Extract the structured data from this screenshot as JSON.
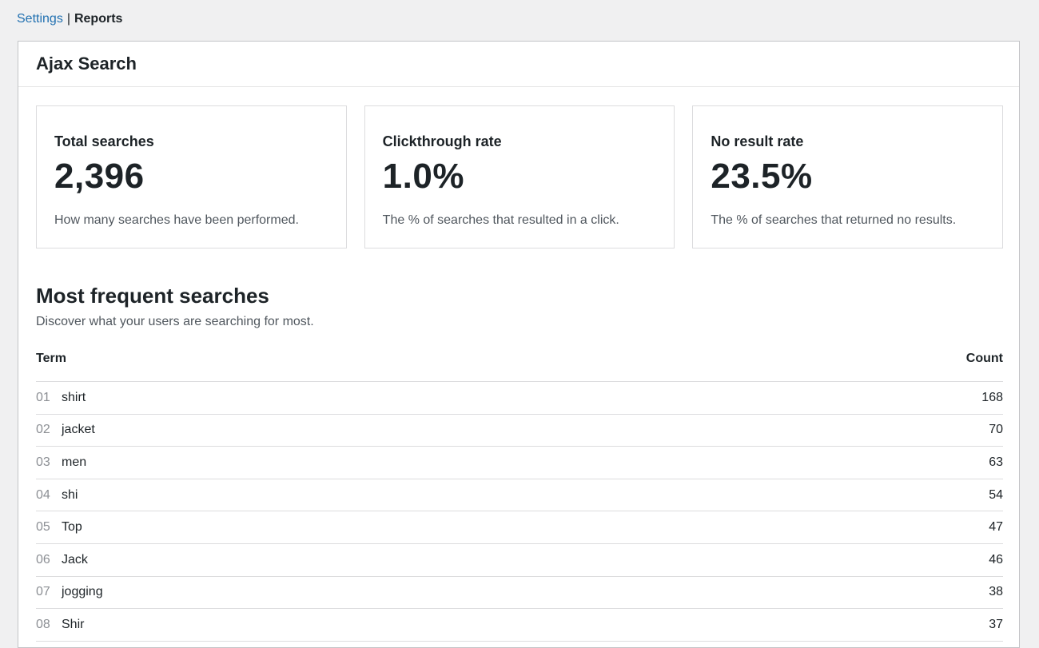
{
  "breadcrumb": {
    "settings_label": "Settings",
    "separator": "|",
    "reports_label": "Reports"
  },
  "panel": {
    "title": "Ajax Search"
  },
  "stats": [
    {
      "title": "Total searches",
      "value": "2,396",
      "description": "How many searches have been performed."
    },
    {
      "title": "Clickthrough rate",
      "value": "1.0%",
      "description": "The % of searches that resulted in a click."
    },
    {
      "title": "No result rate",
      "value": "23.5%",
      "description": "The % of searches that returned no results."
    }
  ],
  "frequent": {
    "title": "Most frequent searches",
    "description": "Discover what your users are searching for most.",
    "columns": {
      "term": "Term",
      "count": "Count"
    },
    "rows": [
      {
        "num": "01",
        "term": "shirt",
        "count": "168"
      },
      {
        "num": "02",
        "term": "jacket",
        "count": "70"
      },
      {
        "num": "03",
        "term": "men",
        "count": "63"
      },
      {
        "num": "04",
        "term": "shi",
        "count": "54"
      },
      {
        "num": "05",
        "term": "Top",
        "count": "47"
      },
      {
        "num": "06",
        "term": "Jack",
        "count": "46"
      },
      {
        "num": "07",
        "term": "jogging",
        "count": "38"
      },
      {
        "num": "08",
        "term": "Shir",
        "count": "37"
      }
    ]
  }
}
